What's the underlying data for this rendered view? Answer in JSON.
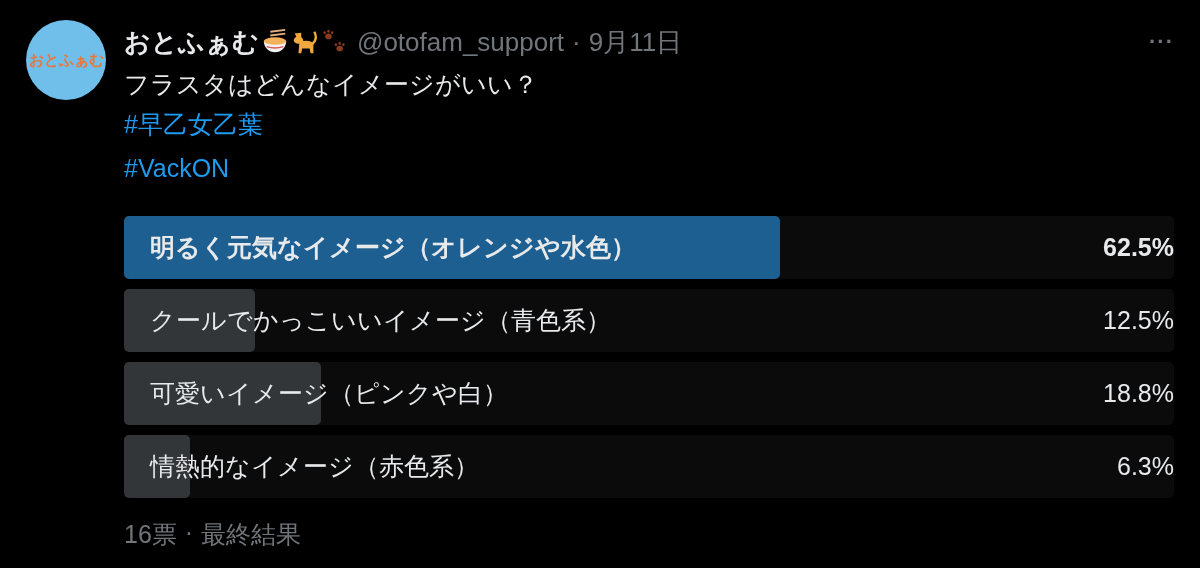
{
  "author": {
    "avatar_text": "おとふぁむ",
    "name": "おとふぁむ",
    "handle": "@otofam_support",
    "separator": "·",
    "date": "9月11日",
    "more": "···"
  },
  "text": "フラスタはどんなイメージがいい？",
  "hashtags": [
    "#早乙女乙葉",
    "#VackON"
  ],
  "poll": {
    "options": [
      {
        "label": "明るく元気なイメージ（オレンジや水色）",
        "percent": "62.5%",
        "level": 0.625,
        "leading": true
      },
      {
        "label": "クールでかっこいいイメージ（青色系）",
        "percent": "12.5%",
        "level": 0.125,
        "leading": false
      },
      {
        "label": "可愛いイメージ（ピンクや白）",
        "percent": "18.8%",
        "level": 0.188,
        "leading": false
      },
      {
        "label": "情熱的なイメージ（赤色系）",
        "percent": "6.3%",
        "level": 0.063,
        "leading": false
      }
    ],
    "votes": "16票",
    "separator": "·",
    "status": "最終結果"
  }
}
